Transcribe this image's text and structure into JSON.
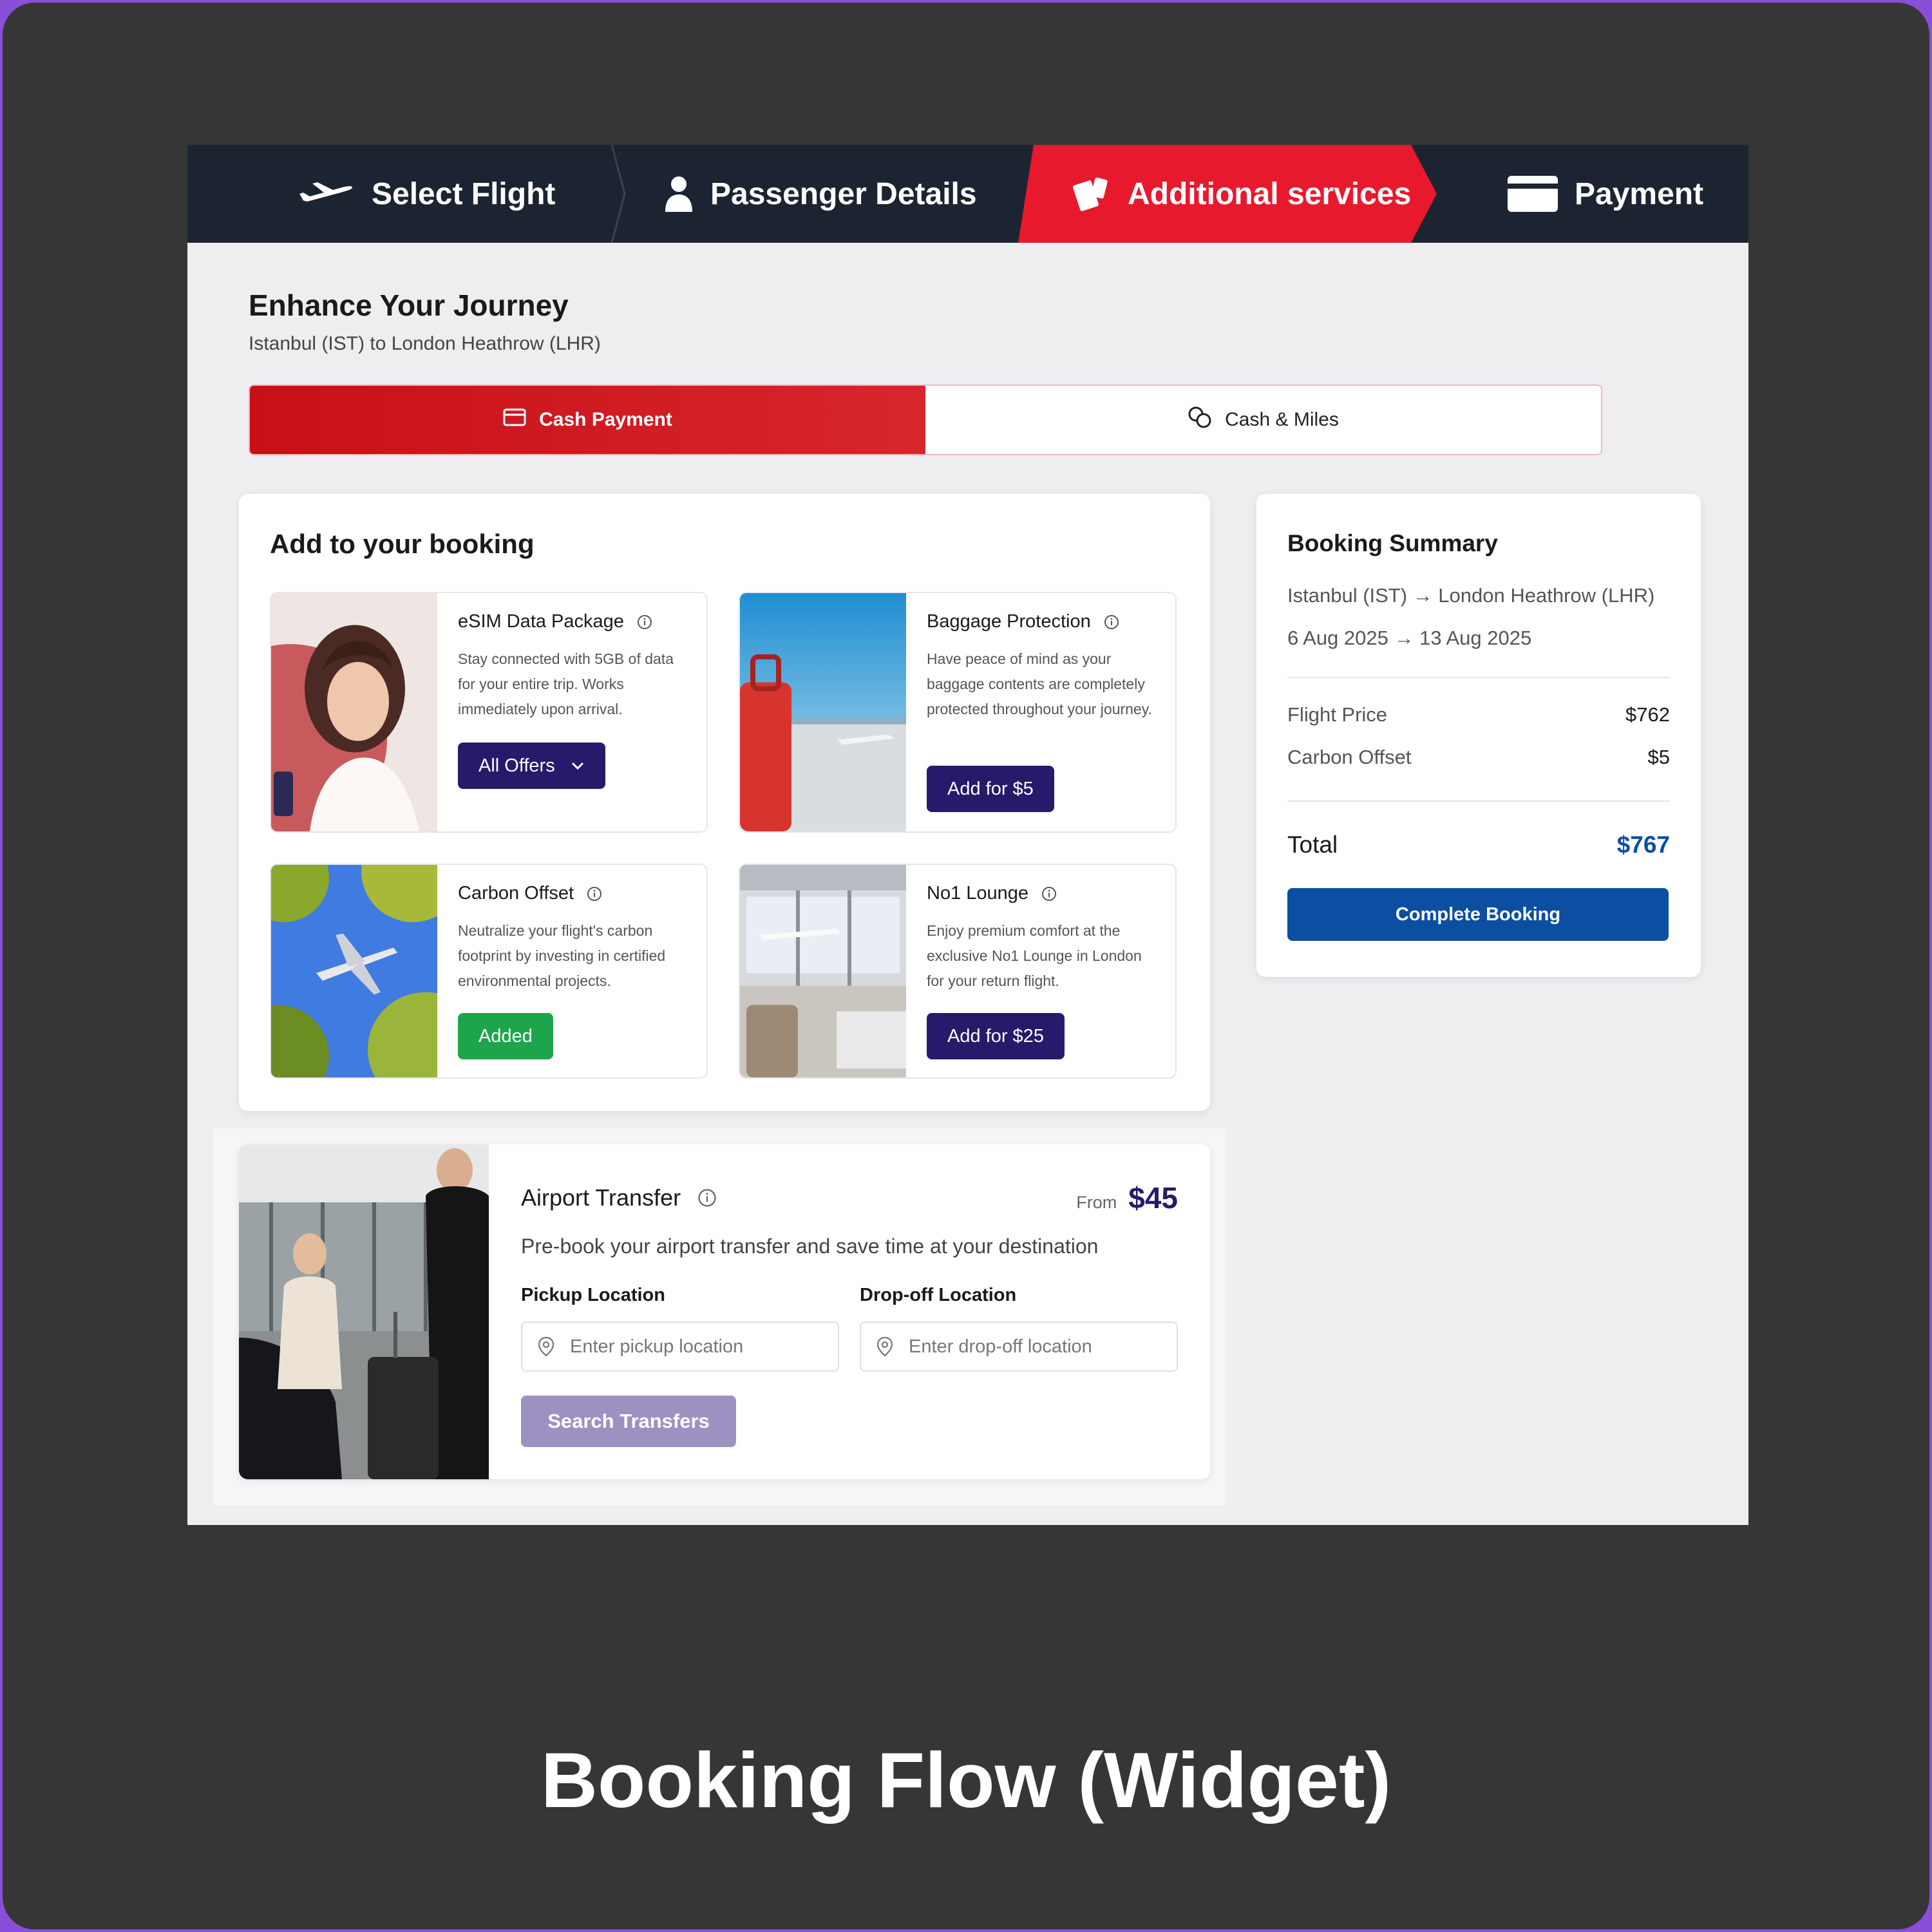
{
  "stepper": {
    "steps": [
      {
        "label": "Select Flight",
        "icon": "plane-icon"
      },
      {
        "label": "Passenger Details",
        "icon": "person-icon"
      },
      {
        "label": "Additional services",
        "icon": "tickets-icon",
        "active": true
      },
      {
        "label": "Payment",
        "icon": "card-icon"
      }
    ],
    "active_color": "#e8192c"
  },
  "header": {
    "title": "Enhance Your Journey",
    "route": "Istanbul (IST) to London Heathrow (LHR)"
  },
  "payment_toggle": {
    "options": [
      {
        "label": "Cash Payment",
        "icon": "credit-card-icon",
        "selected": true
      },
      {
        "label": "Cash & Miles",
        "icon": "coins-icon",
        "selected": false
      }
    ]
  },
  "booking": {
    "title": "Add to your booking",
    "services": [
      {
        "name": "eSIM Data Package",
        "description": "Stay connected with 5GB of data for your entire trip. Works immediately upon arrival.",
        "button": "All Offers",
        "button_icon": "chevron-down-icon"
      },
      {
        "name": "Baggage Protection",
        "description": "Have peace of mind as your baggage contents are completely protected throughout your journey.",
        "button": "Add for $5"
      },
      {
        "name": "Carbon Offset",
        "description": "Neutralize your flight's carbon footprint by investing in certified environmental projects.",
        "button": "Added",
        "status": "added"
      },
      {
        "name": "No1 Lounge",
        "description": "Enjoy premium comfort at the exclusive No1 Lounge in London for your return flight.",
        "button": "Add for $25"
      }
    ]
  },
  "transfer": {
    "title": "Airport Transfer",
    "from_label": "From",
    "price": "$45",
    "description": "Pre-book your airport transfer and save time at your destination",
    "pickup_label": "Pickup Location",
    "pickup_placeholder": "Enter pickup location",
    "dropoff_label": "Drop-off Location",
    "dropoff_placeholder": "Enter drop-off location",
    "search_button": "Search Transfers"
  },
  "summary": {
    "title": "Booking Summary",
    "route": "Istanbul (IST) → London Heathrow (LHR)",
    "dates": "6 Aug 2025 → 13 Aug 2025",
    "lines": [
      {
        "label": "Flight Price",
        "value": "$762"
      },
      {
        "label": "Carbon Offset",
        "value": "$5"
      }
    ],
    "total_label": "Total",
    "total_value": "$767",
    "button": "Complete Booking",
    "accent": "#0b4ea2"
  },
  "caption": "Booking Flow (Widget)"
}
